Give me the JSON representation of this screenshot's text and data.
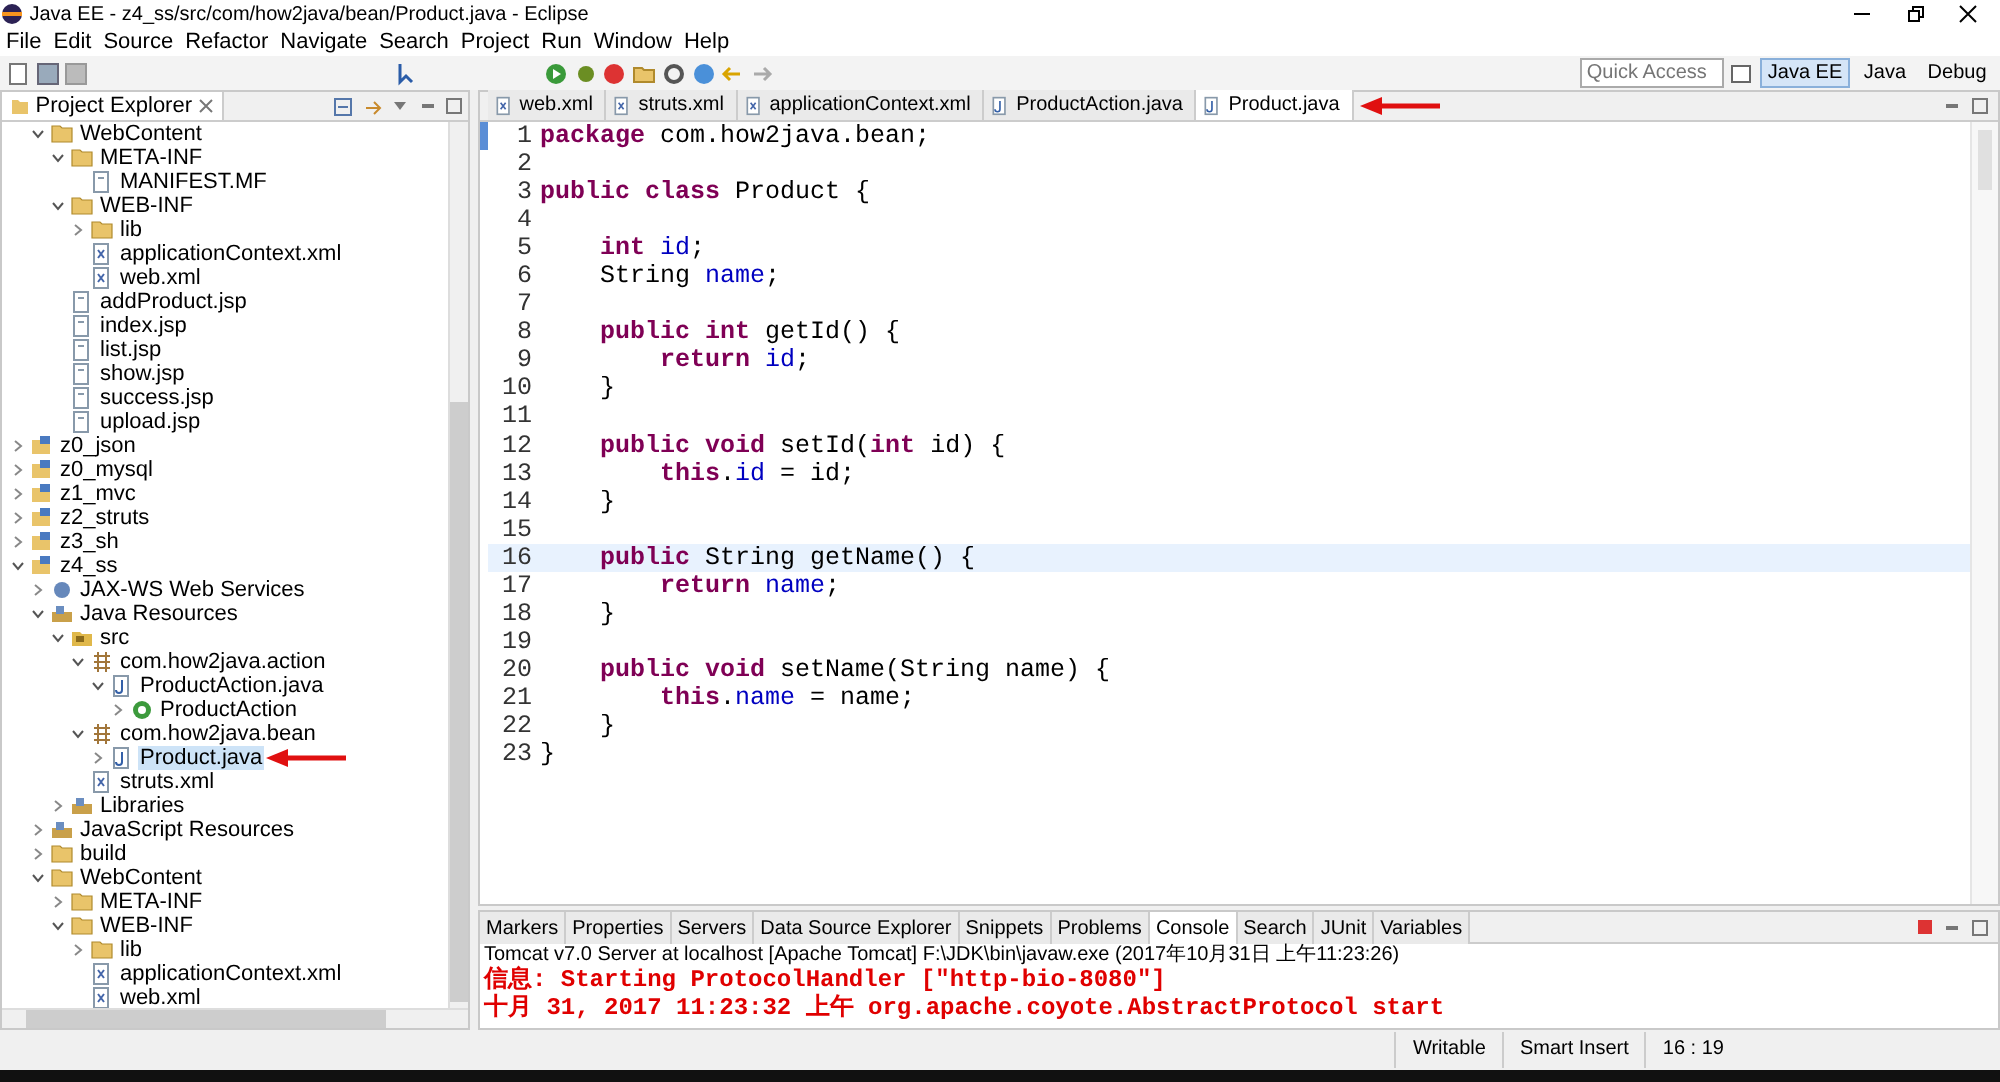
{
  "window": {
    "title": "Java EE - z4_ss/src/com/how2java/bean/Product.java - Eclipse"
  },
  "menu": [
    "File",
    "Edit",
    "Source",
    "Refactor",
    "Navigate",
    "Search",
    "Project",
    "Run",
    "Window",
    "Help"
  ],
  "quick_access": {
    "placeholder": "Quick Access"
  },
  "perspectives": [
    {
      "label": "Java EE",
      "selected": true
    },
    {
      "label": "Java",
      "selected": false
    },
    {
      "label": "Debug",
      "selected": false
    }
  ],
  "project_explorer": {
    "title": "Project Explorer",
    "scrolled_branch": [
      {
        "label": "WebContent",
        "kind": "folder",
        "expanded": true,
        "selected": false,
        "children": [
          {
            "label": "META-INF",
            "kind": "folder",
            "expanded": true,
            "selected": false,
            "children": [
              {
                "label": "MANIFEST.MF",
                "kind": "file",
                "selected": false
              }
            ]
          },
          {
            "label": "WEB-INF",
            "kind": "folder",
            "expanded": true,
            "selected": false,
            "children": [
              {
                "label": "lib",
                "kind": "folder",
                "expanded": false,
                "selected": false
              },
              {
                "label": "applicationContext.xml",
                "kind": "xml",
                "selected": false
              },
              {
                "label": "web.xml",
                "kind": "xml",
                "selected": false
              }
            ]
          },
          {
            "label": "addProduct.jsp",
            "kind": "file",
            "selected": false
          },
          {
            "label": "index.jsp",
            "kind": "file",
            "selected": false
          },
          {
            "label": "list.jsp",
            "kind": "file",
            "selected": false
          },
          {
            "label": "show.jsp",
            "kind": "file",
            "selected": false
          },
          {
            "label": "success.jsp",
            "kind": "file",
            "selected": false
          },
          {
            "label": "upload.jsp",
            "kind": "file",
            "selected": false
          }
        ]
      }
    ],
    "projects": [
      {
        "label": "z0_json",
        "kind": "project",
        "expanded": false,
        "selected": false
      },
      {
        "label": "z0_mysql",
        "kind": "project",
        "expanded": false,
        "selected": false
      },
      {
        "label": "z1_mvc",
        "kind": "project",
        "expanded": false,
        "selected": false
      },
      {
        "label": "z2_struts",
        "kind": "project",
        "expanded": false,
        "selected": false
      },
      {
        "label": "z3_sh",
        "kind": "project",
        "expanded": false,
        "selected": false
      },
      {
        "label": "z4_ss",
        "kind": "project",
        "expanded": true,
        "selected": false,
        "children": [
          {
            "label": "JAX-WS Web Services",
            "kind": "service",
            "expanded": false,
            "selected": false
          },
          {
            "label": "Java Resources",
            "kind": "library",
            "expanded": true,
            "selected": false,
            "children": [
              {
                "label": "src",
                "kind": "source",
                "expanded": true,
                "selected": false,
                "children": [
                  {
                    "label": "com.how2java.action",
                    "kind": "package",
                    "expanded": true,
                    "selected": false,
                    "children": [
                      {
                        "label": "ProductAction.java",
                        "kind": "java",
                        "expanded": true,
                        "selected": false,
                        "children": [
                          {
                            "label": "ProductAction",
                            "kind": "class",
                            "expanded": false,
                            "selected": false
                          }
                        ]
                      }
                    ]
                  },
                  {
                    "label": "com.how2java.bean",
                    "kind": "package",
                    "expanded": true,
                    "selected": false,
                    "children": [
                      {
                        "label": "Product.java",
                        "kind": "java",
                        "expanded": false,
                        "selected": true,
                        "pointed": true
                      }
                    ]
                  },
                  {
                    "label": "struts.xml",
                    "kind": "xml",
                    "selected": false
                  }
                ]
              },
              {
                "label": "Libraries",
                "kind": "library",
                "expanded": false,
                "selected": false
              }
            ]
          },
          {
            "label": "JavaScript Resources",
            "kind": "library",
            "expanded": false,
            "selected": false
          },
          {
            "label": "build",
            "kind": "folder",
            "expanded": false,
            "selected": false
          },
          {
            "label": "WebContent",
            "kind": "folder",
            "expanded": true,
            "selected": false,
            "children": [
              {
                "label": "META-INF",
                "kind": "folder",
                "expanded": false,
                "selected": false
              },
              {
                "label": "WEB-INF",
                "kind": "folder",
                "expanded": true,
                "selected": false,
                "children": [
                  {
                    "label": "lib",
                    "kind": "folder",
                    "expanded": false,
                    "selected": false
                  },
                  {
                    "label": "applicationContext.xml",
                    "kind": "xml",
                    "selected": false
                  },
                  {
                    "label": "web.xml",
                    "kind": "xml",
                    "selected": false
                  }
                ]
              }
            ]
          }
        ]
      }
    ]
  },
  "editor": {
    "tabs": [
      {
        "label": "web.xml",
        "kind": "xml",
        "selected": false
      },
      {
        "label": "struts.xml",
        "kind": "xml",
        "selected": false
      },
      {
        "label": "applicationContext.xml",
        "kind": "xml",
        "selected": false
      },
      {
        "label": "ProductAction.java",
        "kind": "java",
        "selected": false
      },
      {
        "label": "Product.java",
        "kind": "java",
        "selected": true,
        "pointed": true
      }
    ],
    "lines": [
      {
        "number": "1",
        "tokens": [
          {
            "kind": "keyword",
            "text": "package"
          },
          {
            "kind": "plain",
            "text": " com.how2java.bean;"
          }
        ]
      },
      {
        "number": "2"
      },
      {
        "number": "3",
        "tokens": [
          {
            "kind": "keyword",
            "text": "public class"
          },
          {
            "kind": "plain",
            "text": " Product {"
          }
        ]
      },
      {
        "number": "4"
      },
      {
        "number": "5",
        "tokens": [
          {
            "kind": "keyword",
            "text": "    int"
          },
          {
            "kind": "field",
            "text": " id"
          },
          {
            "kind": "plain",
            "text": ";"
          }
        ]
      },
      {
        "number": "6",
        "tokens": [
          {
            "kind": "plain",
            "text": "    String "
          },
          {
            "kind": "field",
            "text": "name"
          },
          {
            "kind": "plain",
            "text": ";"
          }
        ]
      },
      {
        "number": "7"
      },
      {
        "number": "8",
        "tokens": [
          {
            "kind": "keyword",
            "text": "    public int"
          },
          {
            "kind": "plain",
            "text": " getId() {"
          }
        ]
      },
      {
        "number": "9",
        "tokens": [
          {
            "kind": "keyword",
            "text": "        return"
          },
          {
            "kind": "field",
            "text": " id"
          },
          {
            "kind": "plain",
            "text": ";"
          }
        ]
      },
      {
        "number": "10",
        "tokens": [
          {
            "kind": "plain",
            "text": "    }"
          }
        ]
      },
      {
        "number": "11"
      },
      {
        "number": "12",
        "tokens": [
          {
            "kind": "keyword",
            "text": "    public void"
          },
          {
            "kind": "plain",
            "text": " setId("
          },
          {
            "kind": "keyword",
            "text": "int"
          },
          {
            "kind": "plain",
            "text": " id) {"
          }
        ]
      },
      {
        "number": "13",
        "tokens": [
          {
            "kind": "keyword",
            "text": "        this"
          },
          {
            "kind": "plain",
            "text": "."
          },
          {
            "kind": "field",
            "text": "id"
          },
          {
            "kind": "plain",
            "text": " = id;"
          }
        ]
      },
      {
        "number": "14",
        "tokens": [
          {
            "kind": "plain",
            "text": "    }"
          }
        ]
      },
      {
        "number": "15"
      },
      {
        "number": "16",
        "current": true,
        "tokens": [
          {
            "kind": "keyword",
            "text": "    public"
          },
          {
            "kind": "plain",
            "text": " String getName() {"
          }
        ]
      },
      {
        "number": "17",
        "tokens": [
          {
            "kind": "keyword",
            "text": "        return"
          },
          {
            "kind": "field",
            "text": " name"
          },
          {
            "kind": "plain",
            "text": ";"
          }
        ]
      },
      {
        "number": "18",
        "tokens": [
          {
            "kind": "plain",
            "text": "    }"
          }
        ]
      },
      {
        "number": "19"
      },
      {
        "number": "20",
        "tokens": [
          {
            "kind": "keyword",
            "text": "    public void"
          },
          {
            "kind": "plain",
            "text": " setName(String name) {"
          }
        ]
      },
      {
        "number": "21",
        "tokens": [
          {
            "kind": "keyword",
            "text": "        this"
          },
          {
            "kind": "plain",
            "text": "."
          },
          {
            "kind": "field",
            "text": "name"
          },
          {
            "kind": "plain",
            "text": " = name;"
          }
        ]
      },
      {
        "number": "22",
        "tokens": [
          {
            "kind": "plain",
            "text": "    }"
          }
        ]
      },
      {
        "number": "23",
        "tokens": [
          {
            "kind": "plain",
            "text": "}"
          }
        ]
      }
    ]
  },
  "bottom_panel": {
    "tabs": [
      {
        "label": "Markers",
        "selected": false
      },
      {
        "label": "Properties",
        "selected": false
      },
      {
        "label": "Servers",
        "selected": false
      },
      {
        "label": "Data Source Explorer",
        "selected": false
      },
      {
        "label": "Snippets",
        "selected": false
      },
      {
        "label": "Problems",
        "selected": false
      },
      {
        "label": "Console",
        "selected": true
      },
      {
        "label": "Search",
        "selected": false
      },
      {
        "label": "JUnit",
        "selected": false
      },
      {
        "label": "Variables",
        "selected": false
      }
    ],
    "console_title": "Tomcat v7.0 Server at localhost [Apache Tomcat] F:\\JDK\\bin\\javaw.exe (2017年10月31日 上午11:23:26)",
    "console_lines": [
      "信息: Starting ProtocolHandler [\"http-bio-8080\"]",
      "十月 31, 2017 11:23:32 上午 org.apache.coyote.AbstractProtocol start"
    ]
  },
  "status_bar": [
    "Writable",
    "Smart Insert",
    "16 : 19"
  ]
}
